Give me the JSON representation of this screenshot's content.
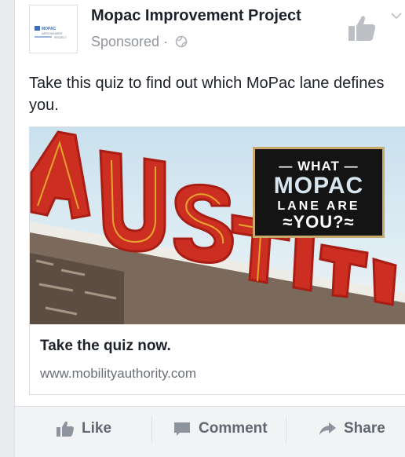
{
  "post": {
    "page_name": "Mopac Improvement Project",
    "sponsored_label": "Sponsored",
    "sponsored_separator": "·",
    "body_text": "Take this quiz to find out which MoPac lane defines you."
  },
  "logo": {
    "line1": "MOPAC",
    "line2": "IMPROVEMENT",
    "line3": "PROJECT"
  },
  "attachment": {
    "promo": {
      "what": "— WHAT —",
      "mopac": "MOPAC",
      "lane_are": "LANE ARE",
      "you": "≈YOU?≈"
    },
    "title": "Take the quiz now.",
    "url": "www.mobilityauthority.com"
  },
  "actions": {
    "like": "Like",
    "comment": "Comment",
    "share": "Share"
  },
  "icons": [
    "like-page-icon",
    "chevron-down-icon",
    "globe-icon",
    "like-icon",
    "comment-icon",
    "share-icon"
  ],
  "colors": {
    "sign_red": "#c8281e",
    "sky": "#dcebf3",
    "promo_bg": "#141414",
    "promo_border": "#c9a86b",
    "action_text": "#606770"
  }
}
